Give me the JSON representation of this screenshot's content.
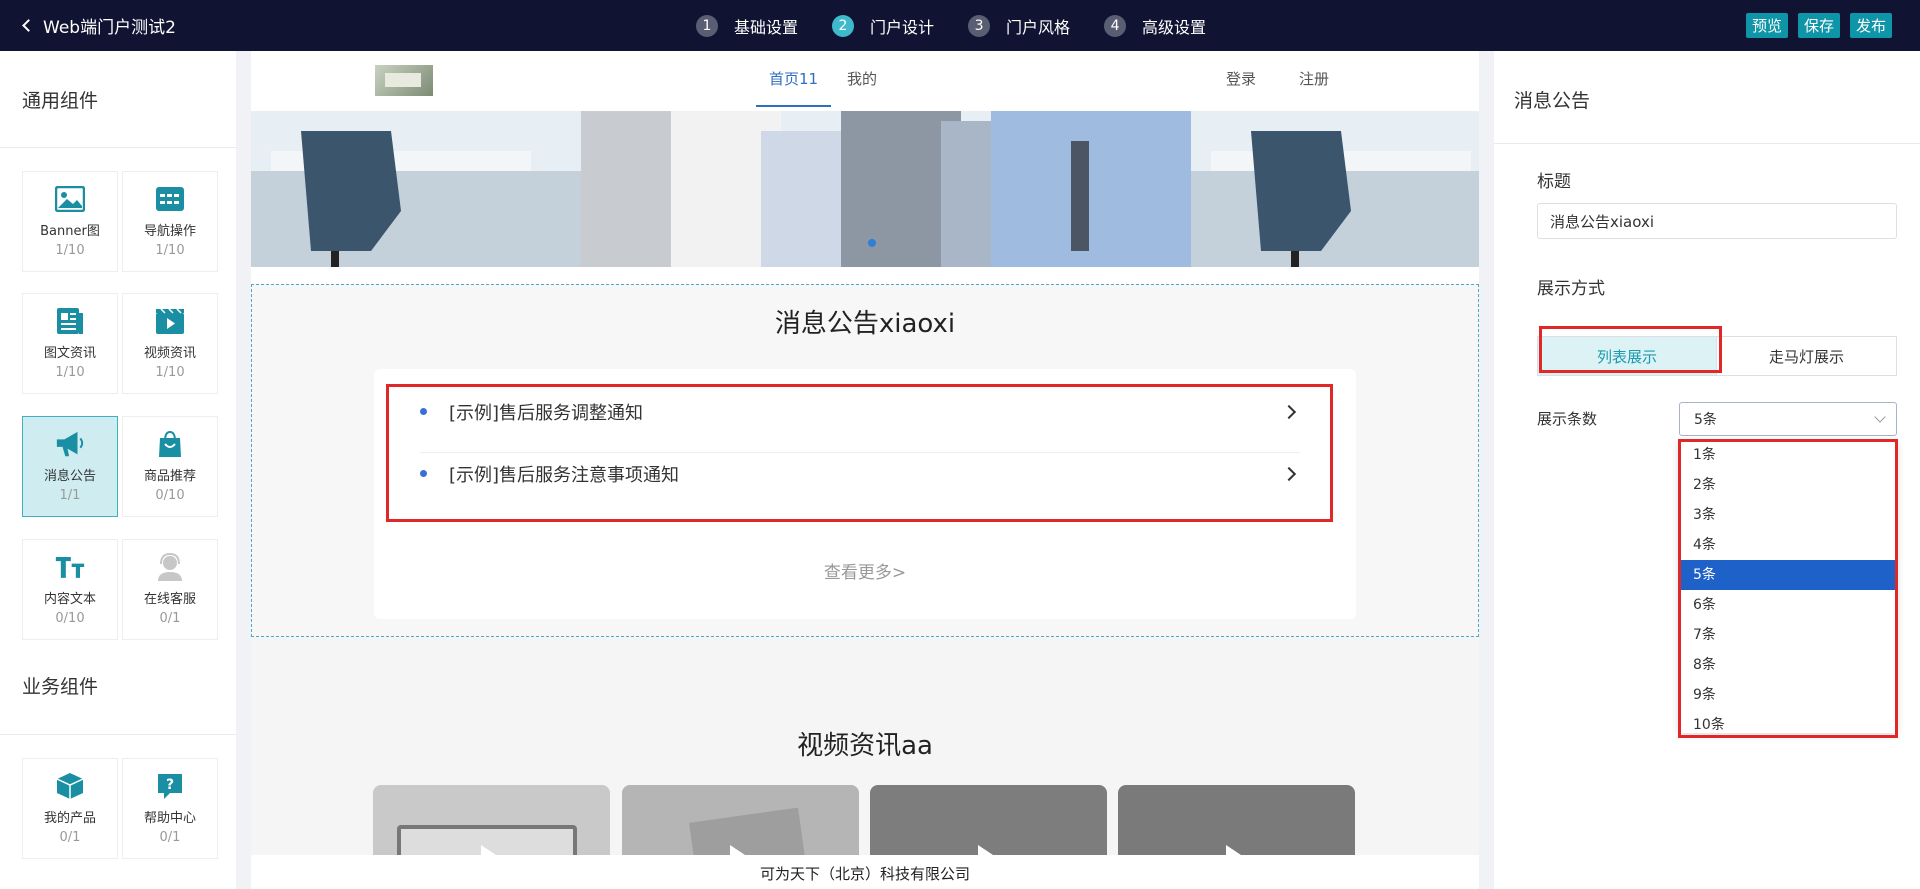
{
  "topbar": {
    "back_label": "Web端门户测试2",
    "steps": [
      {
        "num": "1",
        "label": "基础设置"
      },
      {
        "num": "2",
        "label": "门户设计"
      },
      {
        "num": "3",
        "label": "门户风格"
      },
      {
        "num": "4",
        "label": "高级设置"
      }
    ],
    "buttons": {
      "preview": "预览",
      "save": "保存",
      "publish": "发布"
    }
  },
  "left": {
    "general_title": "通用组件",
    "business_title": "业务组件",
    "general": [
      {
        "name": "Banner图",
        "count": "1/10",
        "icon": "image-icon"
      },
      {
        "name": "导航操作",
        "count": "1/10",
        "icon": "nav-icon"
      },
      {
        "name": "图文资讯",
        "count": "1/10",
        "icon": "article-icon"
      },
      {
        "name": "视频资讯",
        "count": "1/10",
        "icon": "video-icon"
      },
      {
        "name": "消息公告",
        "count": "1/1",
        "icon": "megaphone-icon"
      },
      {
        "name": "商品推荐",
        "count": "0/10",
        "icon": "shopping-bag-icon"
      },
      {
        "name": "内容文本",
        "count": "0/10",
        "icon": "text-icon"
      },
      {
        "name": "在线客服",
        "count": "0/1",
        "icon": "support-icon"
      }
    ],
    "business": [
      {
        "name": "我的产品",
        "count": "0/1",
        "icon": "box-icon"
      },
      {
        "name": "帮助中心",
        "count": "0/1",
        "icon": "help-icon"
      }
    ]
  },
  "canvas": {
    "nav": {
      "home": "首页11",
      "mine": "我的",
      "login": "登录",
      "register": "注册"
    },
    "notice": {
      "title": "消息公告xiaoxi",
      "items": [
        "[示例]售后服务调整通知",
        "[示例]售后服务注意事项通知"
      ],
      "more": "查看更多>"
    },
    "video": {
      "title": "视频资讯aa"
    },
    "footer": "可为天下（北京）科技有限公司"
  },
  "right": {
    "panel_title": "消息公告",
    "title_label": "标题",
    "title_value": "消息公告xiaoxi",
    "display_label": "展示方式",
    "display_options": {
      "list": "列表展示",
      "marquee": "走马灯展示"
    },
    "count_label": "展示条数",
    "count_selected": "5条",
    "count_options": [
      "1条",
      "2条",
      "3条",
      "4条",
      "5条",
      "6条",
      "7条",
      "8条",
      "9条",
      "10条"
    ]
  },
  "colors": {
    "accent": "#0e95a8",
    "topbar": "#101432",
    "highlight": "#e02828",
    "selected": "#1d61c9"
  }
}
